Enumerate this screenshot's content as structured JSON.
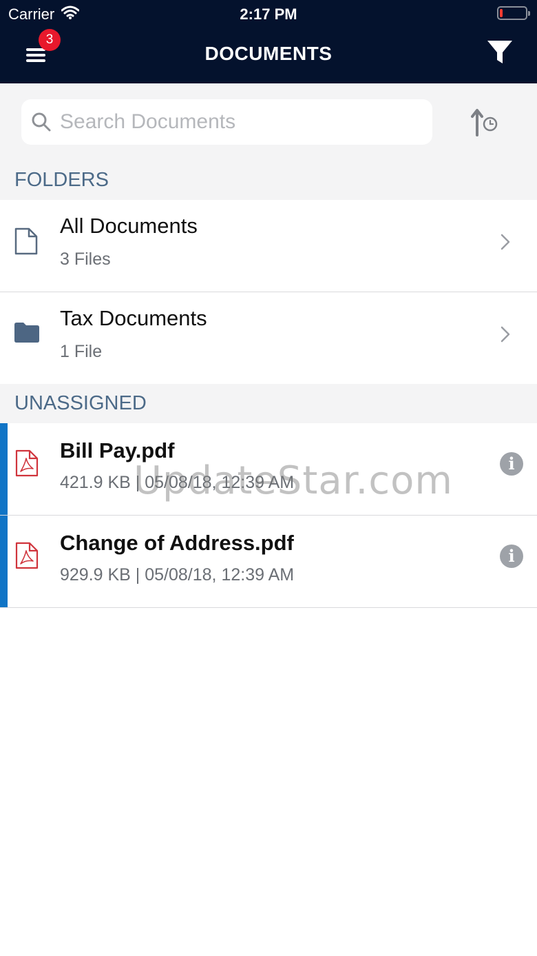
{
  "status_bar": {
    "carrier": "Carrier",
    "time": "2:17 PM",
    "battery_level": 0.12
  },
  "header": {
    "title": "DOCUMENTS",
    "badge_count": "3"
  },
  "search": {
    "placeholder": "Search Documents",
    "value": ""
  },
  "sections": {
    "folders": "FOLDERS",
    "unassigned": "UNASSIGNED"
  },
  "folders": [
    {
      "name": "All Documents",
      "count": "3 Files",
      "icon": "document-icon"
    },
    {
      "name": "Tax Documents",
      "count": "1 File",
      "icon": "folder-icon"
    }
  ],
  "files": [
    {
      "name": "Bill Pay.pdf",
      "meta": "421.9 KB | 05/08/18, 12:39 AM",
      "icon": "pdf-icon"
    },
    {
      "name": "Change of Address.pdf",
      "meta": "929.9 KB | 05/08/18, 12:39 AM",
      "icon": "pdf-icon"
    }
  ],
  "watermark": "UpdateStar.com",
  "colors": {
    "header_bg": "#04122d",
    "accent": "#0f74c6",
    "section_text": "#4c6a88",
    "badge": "#e8192c",
    "pdf": "#d0343c"
  }
}
